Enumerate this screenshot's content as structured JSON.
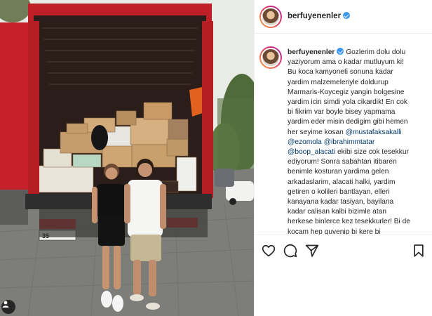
{
  "post": {
    "username": "berfuyenenler",
    "verified": true,
    "caption": {
      "username": "berfuyenenler",
      "line1_text": "Gozlerim dolu dolu",
      "line2": "yaziyorum ama o kadar mutluyum ki!",
      "line3": "Bu koca kamyoneti sonuna kadar",
      "line4": "yardim malzemeleriyle doldurup",
      "line5": "Marmaris-Koycegiz yangin bolgesine",
      "line6": "yardim icin simdi yola cikardik! En cok",
      "line7": "bi fikrim var boyle bisey yapmama",
      "line8": "yardim eder misin dedigim gibi hemen",
      "line9_text": "her seyime kosan",
      "mention1": "@mustafaksakalli",
      "mention2": "@ezomola",
      "mention3": "@ibrahimmtatar",
      "mention4": "@boop_alacati",
      "line11_text": "ekibi size cok tesekkur",
      "line12": "ediyorum! Sonra sabahtan itibaren",
      "line13": "benimle kosturan yardima gelen",
      "line14": "arkadaslarim, alacati halki, yardim",
      "line15": "getiren o kolileri bantlayan, elleri",
      "line16": "kanayana kadar tasiyan, bayilana",
      "line17": "kadar calisan kalbi bizimle atan",
      "line18": "herkese binlerce kez tesekkurler! Bi de",
      "line19": "kocam hep guvenip bi kere bi"
    }
  },
  "photo": {
    "truck_plate": "35",
    "truck_color": "#c8202a"
  },
  "icons": {
    "header_avatar": "profile-avatar",
    "verified": "verified-badge-icon",
    "like": "heart-icon",
    "comment": "comment-bubble-icon",
    "share": "paper-plane-icon",
    "save": "bookmark-icon",
    "tagged_user": "person-tag-icon"
  },
  "colors": {
    "verified": "#3897f0",
    "mention": "#00376b",
    "text": "#262626",
    "divider": "#efefef"
  }
}
